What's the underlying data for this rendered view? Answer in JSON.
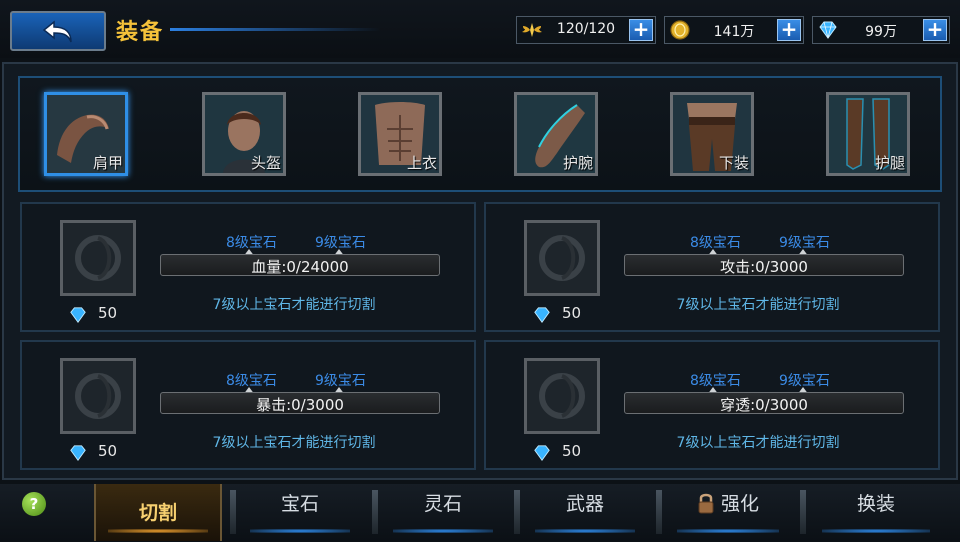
{
  "header": {
    "title": "装备",
    "back_icon": "back-arrow-icon"
  },
  "resources": [
    {
      "name": "stamina",
      "icon": "wings-icon",
      "value": "120/120"
    },
    {
      "name": "gold",
      "icon": "coin-icon",
      "value": "141万"
    },
    {
      "name": "diamond",
      "icon": "diamond-icon",
      "value": "99万"
    }
  ],
  "equipment_slots": [
    {
      "label": "肩甲",
      "selected": true
    },
    {
      "label": "头盔",
      "selected": false
    },
    {
      "label": "上衣",
      "selected": false
    },
    {
      "label": "护腕",
      "selected": false
    },
    {
      "label": "下装",
      "selected": false
    },
    {
      "label": "护腿",
      "selected": false
    }
  ],
  "panels": [
    {
      "level8": "8级宝石",
      "level9": "9级宝石",
      "stat": "血量:0/24000",
      "hint": "7级以上宝石才能进行切割",
      "cost": "50"
    },
    {
      "level8": "8级宝石",
      "level9": "9级宝石",
      "stat": "攻击:0/3000",
      "hint": "7级以上宝石才能进行切割",
      "cost": "50"
    },
    {
      "level8": "8级宝石",
      "level9": "9级宝石",
      "stat": "暴击:0/3000",
      "hint": "7级以上宝石才能进行切割",
      "cost": "50"
    },
    {
      "level8": "8级宝石",
      "level9": "9级宝石",
      "stat": "穿透:0/3000",
      "hint": "7级以上宝石才能进行切割",
      "cost": "50"
    }
  ],
  "tabs": [
    {
      "label": "切割",
      "active": true
    },
    {
      "label": "宝石",
      "active": false
    },
    {
      "label": "灵石",
      "active": false
    },
    {
      "label": "武器",
      "active": false
    },
    {
      "label": "强化",
      "active": false,
      "icon": "lock-icon"
    },
    {
      "label": "换装",
      "active": false
    }
  ],
  "help": "?",
  "colors": {
    "accent_gold": "#f5c23a",
    "accent_blue": "#3b8be6",
    "hint_blue": "#5fb6e6"
  }
}
